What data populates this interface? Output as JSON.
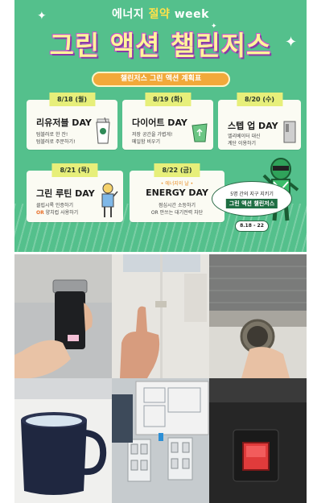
{
  "poster": {
    "top_title_a": "에너지 ",
    "top_title_b": "절약",
    "top_title_c": " week",
    "main_title": "그린 액션 챌린저스",
    "plan_label": "챌린저스 그린 액션 계획표",
    "cards": [
      {
        "date": "8/18 (월)",
        "title": "리유저블 DAY",
        "desc1": "텀블러로 한 잔!",
        "desc2": "텀블러로 주문하기!"
      },
      {
        "date": "8/19 (화)",
        "title": "다이어트 DAY",
        "desc1": "저장 공간을 가볍게!",
        "desc2": "메일함 비우기"
      },
      {
        "date": "8/20 (수)",
        "title": "스텝 업 DAY",
        "desc1": "엘리베이터 대신",
        "desc2": "계단 이용하기"
      },
      {
        "date": "8/21 (목)",
        "title": "그린 루틴 DAY",
        "desc1": "클립시록 인증하기",
        "desc2_or": "OR",
        "desc2": " 양치컵 사용하기"
      },
      {
        "date": "8/22 (금)",
        "badge": "• 에너지의 날 •",
        "title": "ENERGY DAY",
        "desc1": "점심시간 소등하기",
        "desc2_or": "OR",
        "desc2_a": "안쓰는 ",
        "desc2": "대기전력 차단"
      }
    ],
    "bubble_line1": "5명 간의 지구 지키기",
    "bubble_line2": "그린 액션 챌린저스",
    "date_range": "8.18 - 22"
  },
  "photos": [
    {
      "subject": "tumbler-held"
    },
    {
      "subject": "thumbs-up-elevator"
    },
    {
      "subject": "cup-at-sink"
    },
    {
      "subject": "mug-with-ice"
    },
    {
      "subject": "light-switches"
    },
    {
      "subject": "power-switch"
    }
  ],
  "colors": {
    "poster_bg": "#54c08c",
    "accent_orange": "#f2a93a",
    "tag_yellow": "#e7ef7a"
  }
}
